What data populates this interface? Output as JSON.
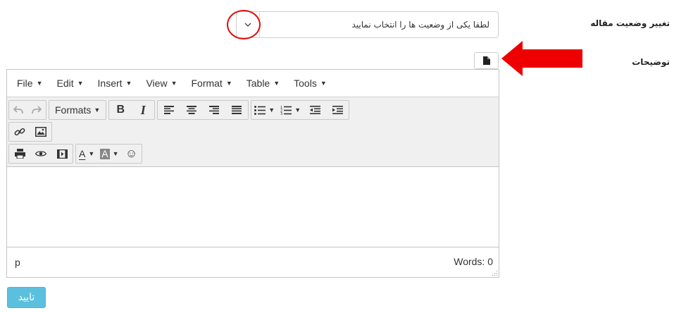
{
  "form": {
    "status_label": "تغییر وضعیت مقاله",
    "status_placeholder": "لطفا یکی از وضعیت ها را انتخاب نمایید",
    "description_label": "توضیحات"
  },
  "editor": {
    "menubar": [
      {
        "label": "File"
      },
      {
        "label": "Edit"
      },
      {
        "label": "Insert"
      },
      {
        "label": "View"
      },
      {
        "label": "Format"
      },
      {
        "label": "Table"
      },
      {
        "label": "Tools"
      }
    ],
    "toolbar": {
      "formats_label": "Formats",
      "bold_label": "B",
      "italic_label": "I",
      "font_color_label": "A",
      "bg_color_label": "A",
      "emoticon_label": "☺"
    },
    "statusbar": {
      "path": "p",
      "word_count": "Words: 0"
    }
  },
  "buttons": {
    "confirm_label": "تایید"
  },
  "colors": {
    "annotation_red": "#e01010",
    "confirm_button": "#5bc0de"
  }
}
